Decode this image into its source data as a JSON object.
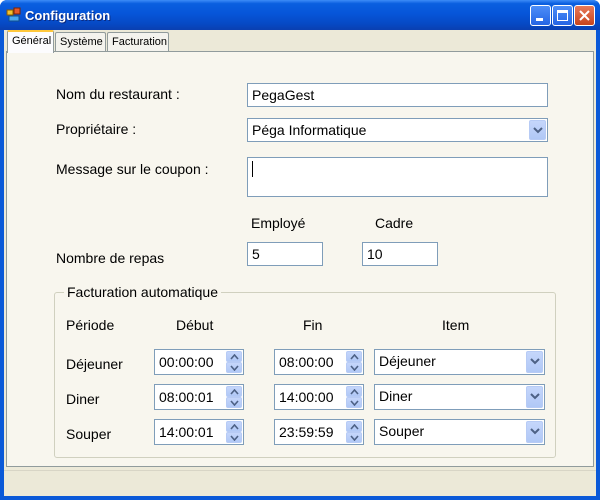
{
  "window": {
    "title": "Configuration"
  },
  "tabs": [
    {
      "label": "Général",
      "active": true
    },
    {
      "label": "Système",
      "active": false
    },
    {
      "label": "Facturation",
      "active": false
    }
  ],
  "form": {
    "restaurant_label": "Nom du restaurant :",
    "restaurant_value": "PegaGest",
    "owner_label": "Propriétaire :",
    "owner_value": "Péga Informatique",
    "message_label": "Message sur le coupon :",
    "message_value": "",
    "employee_header": "Employé",
    "manager_header": "Cadre",
    "meals_label": "Nombre de repas",
    "meals_employee": "5",
    "meals_manager": "10"
  },
  "billing": {
    "title": "Facturation automatique",
    "headers": {
      "period": "Période",
      "start": "Début",
      "end": "Fin",
      "item": "Item"
    },
    "rows": [
      {
        "period": "Déjeuner",
        "start": "00:00:00",
        "end": "08:00:00",
        "item": "Déjeuner"
      },
      {
        "period": "Diner",
        "start": "08:00:01",
        "end": "14:00:00",
        "item": "Diner"
      },
      {
        "period": "Souper",
        "start": "14:00:01",
        "end": "23:59:59",
        "item": "Souper"
      }
    ]
  },
  "colors": {
    "titlebar": "#0a59d8",
    "dialog_bg": "#ece9d8",
    "tab_accent": "#ffc83c",
    "field_border": "#7f9db9"
  }
}
